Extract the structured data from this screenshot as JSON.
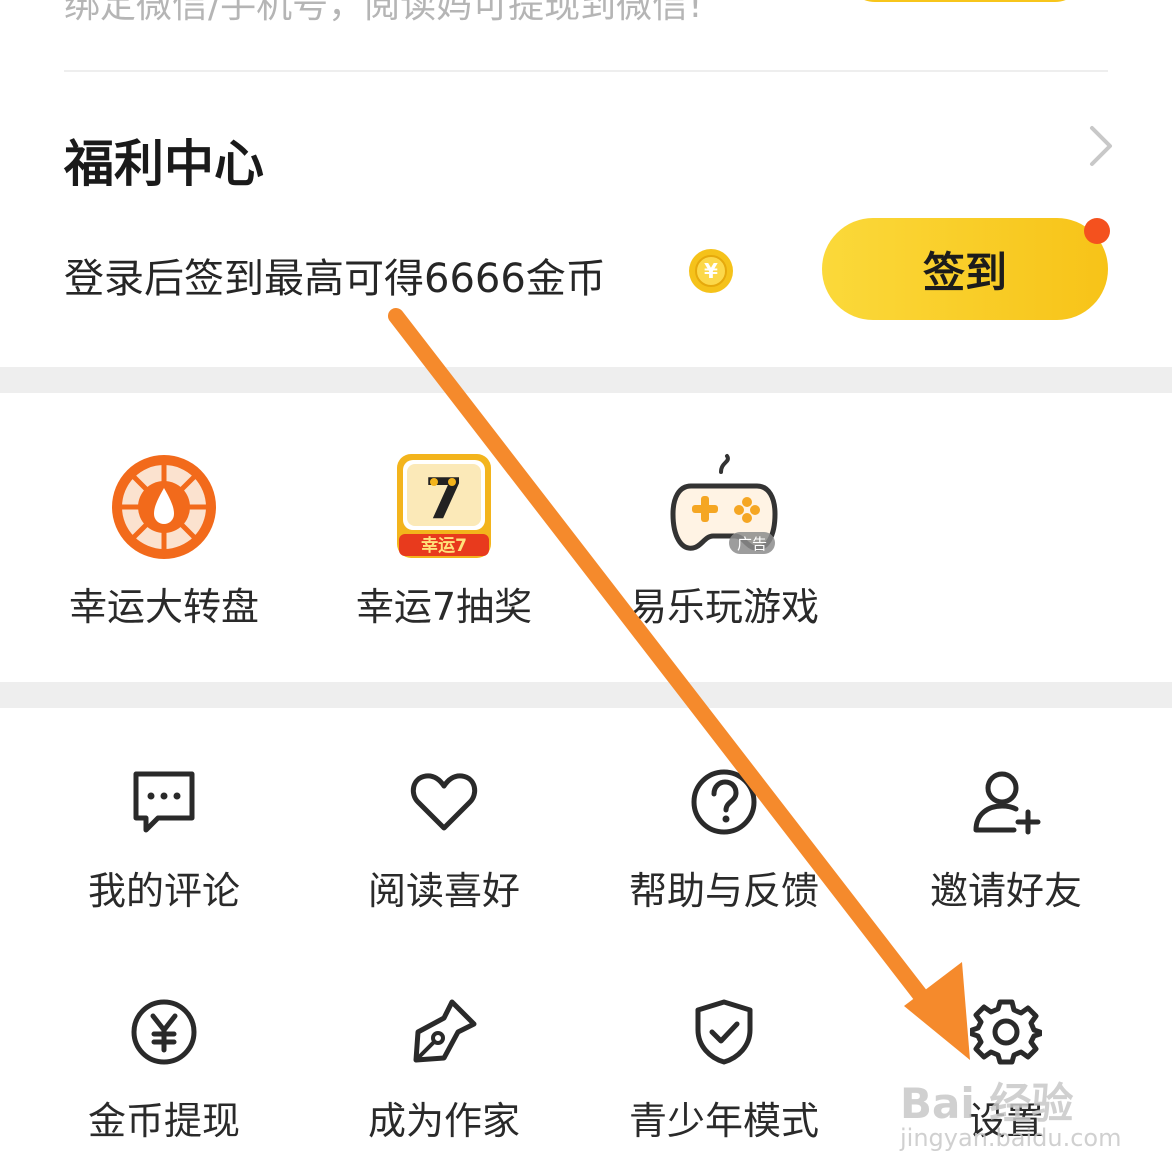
{
  "top_hint": "绑定微信/手机号，阅读妈可提现到微信!",
  "welfare": {
    "title": "福利中心",
    "sign_desc": "登录后签到最高可得6666金币",
    "sign_button": "签到"
  },
  "features": [
    {
      "label": "幸运大转盘",
      "icon": "lucky-wheel-icon"
    },
    {
      "label": "幸运7抽奖",
      "icon": "lucky-seven-icon"
    },
    {
      "label": "易乐玩游戏",
      "icon": "gamepad-icon",
      "badge": "广告"
    }
  ],
  "lucky_seven_icon": {
    "digit": "7",
    "caption": "幸运7"
  },
  "coin_symbol": "¥",
  "tools": [
    {
      "label": "我的评论",
      "icon": "comment-icon"
    },
    {
      "label": "阅读喜好",
      "icon": "heart-icon"
    },
    {
      "label": "帮助与反馈",
      "icon": "help-icon"
    },
    {
      "label": "邀请好友",
      "icon": "add-user-icon"
    },
    {
      "label": "金币提现",
      "icon": "yuan-coin-icon"
    },
    {
      "label": "成为作家",
      "icon": "pen-nib-icon"
    },
    {
      "label": "青少年模式",
      "icon": "shield-check-icon"
    },
    {
      "label": "设置",
      "icon": "gear-icon"
    }
  ],
  "watermark": {
    "brand": "Bai 经验",
    "url": "jingyan.baidu.com"
  },
  "colors": {
    "accent_yellow": "#f7c518",
    "annotation_arrow": "#f58a2c",
    "red_dot": "#f4511e",
    "wheel_orange": "#f26a1b"
  }
}
